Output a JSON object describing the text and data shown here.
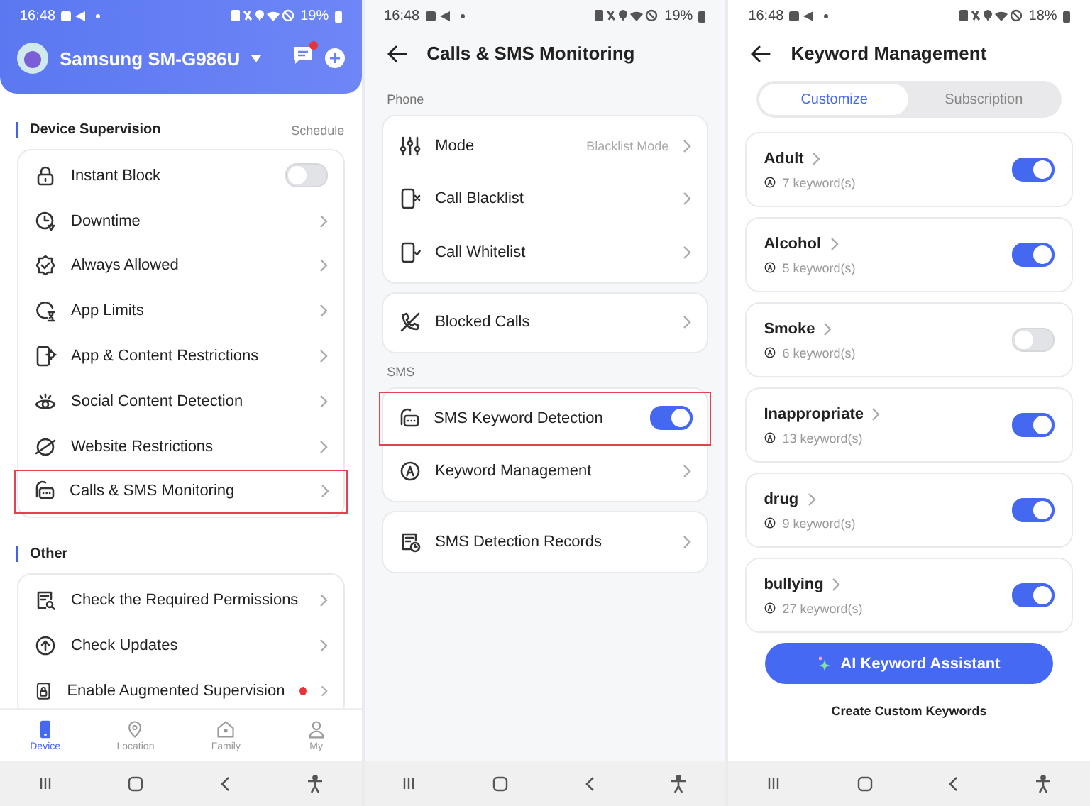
{
  "device_screen": {
    "status_bar": {
      "time": "16:48",
      "battery": "19%"
    },
    "header": {
      "device_name": "Samsung SM-G986U",
      "unread_messages": true
    },
    "sections": [
      {
        "title": "Device Supervision",
        "action": "Schedule",
        "items": [
          {
            "label": "Instant Block",
            "kind": "toggle",
            "on": false,
            "highlighted": false,
            "alert": false
          },
          {
            "label": "Downtime",
            "kind": "link",
            "highlighted": false,
            "alert": false
          },
          {
            "label": "Always Allowed",
            "kind": "link",
            "highlighted": false,
            "alert": false
          },
          {
            "label": "App Limits",
            "kind": "link",
            "highlighted": false,
            "alert": false
          },
          {
            "label": "App & Content Restrictions",
            "kind": "link",
            "highlighted": false,
            "alert": false
          },
          {
            "label": "Social Content Detection",
            "kind": "link",
            "highlighted": false,
            "alert": false
          },
          {
            "label": "Website Restrictions",
            "kind": "link",
            "highlighted": false,
            "alert": false
          },
          {
            "label": "Calls & SMS Monitoring",
            "kind": "link",
            "highlighted": true,
            "alert": false
          }
        ]
      },
      {
        "title": "Other",
        "items": [
          {
            "label": "Check the Required Permissions",
            "kind": "link",
            "highlighted": false,
            "alert": false
          },
          {
            "label": "Check Updates",
            "kind": "link",
            "highlighted": false,
            "alert": false
          },
          {
            "label": "Enable Augmented Supervision",
            "kind": "link",
            "highlighted": false,
            "alert": true
          }
        ]
      }
    ],
    "tabs": [
      {
        "label": "Device",
        "selected": true
      },
      {
        "label": "Location",
        "selected": false
      },
      {
        "label": "Family",
        "selected": false
      },
      {
        "label": "My",
        "selected": false
      }
    ]
  },
  "calls_screen": {
    "status_bar": {
      "time": "16:48",
      "battery": "19%"
    },
    "title": "Calls & SMS Monitoring",
    "groups": [
      {
        "heading": "Phone",
        "cards": [
          [
            {
              "label": "Mode",
              "kind": "value",
              "value": "Blacklist Mode",
              "highlighted": false
            },
            {
              "label": "Call Blacklist",
              "kind": "link",
              "highlighted": false
            },
            {
              "label": "Call Whitelist",
              "kind": "link",
              "highlighted": false
            }
          ],
          [
            {
              "label": "Blocked Calls",
              "kind": "link",
              "highlighted": false
            }
          ]
        ]
      },
      {
        "heading": "SMS",
        "cards": [
          [
            {
              "label": "SMS Keyword Detection",
              "kind": "toggle",
              "on": true,
              "highlighted": true
            },
            {
              "label": "Keyword Management",
              "kind": "link",
              "highlighted": false
            }
          ],
          [
            {
              "label": "SMS Detection Records",
              "kind": "link",
              "highlighted": false
            }
          ]
        ]
      }
    ]
  },
  "keywords_screen": {
    "status_bar": {
      "time": "16:48",
      "battery": "18%"
    },
    "title": "Keyword Management",
    "segments": [
      {
        "label": "Customize",
        "selected": true
      },
      {
        "label": "Subscription",
        "selected": false
      }
    ],
    "categories": [
      {
        "name": "Adult",
        "count": "7 keyword(s)",
        "on": true
      },
      {
        "name": "Alcohol",
        "count": "5 keyword(s)",
        "on": true
      },
      {
        "name": "Smoke",
        "count": "6 keyword(s)",
        "on": false
      },
      {
        "name": "Inappropriate",
        "count": "13 keyword(s)",
        "on": true
      },
      {
        "name": "drug",
        "count": "9 keyword(s)",
        "on": true
      },
      {
        "name": "bullying",
        "count": "27 keyword(s)",
        "on": true
      }
    ],
    "assistant_button": "AI Keyword Assistant",
    "create_link": "Create Custom Keywords"
  }
}
